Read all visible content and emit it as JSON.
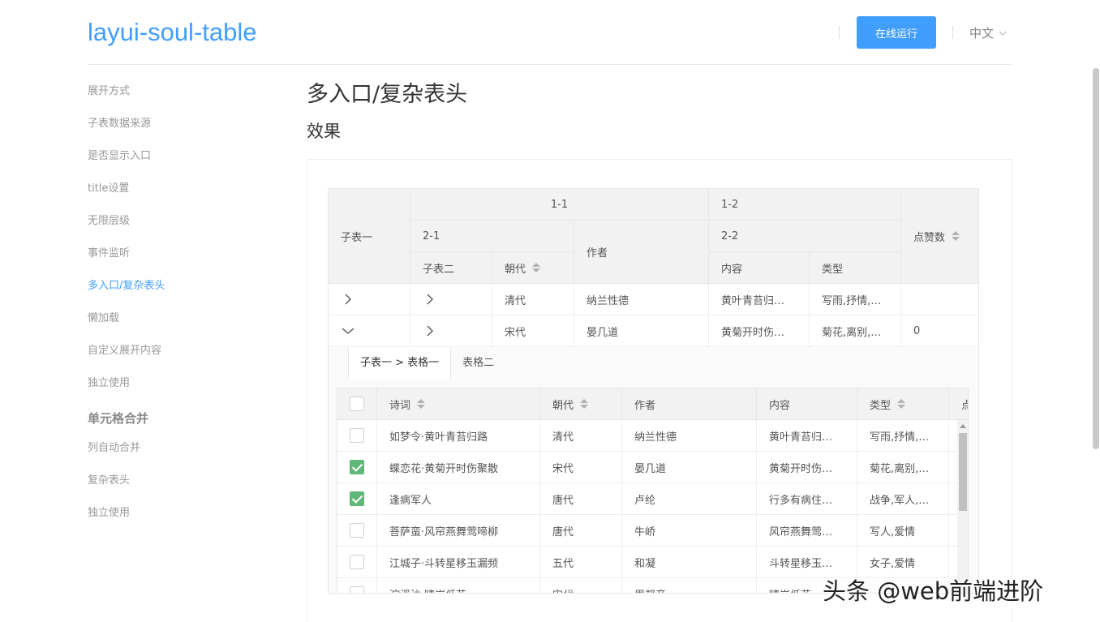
{
  "header": {
    "logo": "layui-soul-table",
    "run_button": "在线运行",
    "language": "中文"
  },
  "sidebar": {
    "items": [
      {
        "label": "展开方式"
      },
      {
        "label": "子表数据来源"
      },
      {
        "label": "是否显示入口"
      },
      {
        "label": "title设置"
      },
      {
        "label": "无限层级"
      },
      {
        "label": "事件监听"
      },
      {
        "label": "多入口/复杂表头",
        "active": true
      },
      {
        "label": "懒加载"
      },
      {
        "label": "自定义展开内容"
      },
      {
        "label": "独立使用"
      }
    ],
    "group_title": "单元格合并",
    "group_items": [
      {
        "label": "列自动合并"
      },
      {
        "label": "复杂表头"
      },
      {
        "label": "独立使用"
      }
    ]
  },
  "main": {
    "page_title": "多入口/复杂表头",
    "section_title": "效果"
  },
  "outer_table": {
    "headers": {
      "col_child1": "子表一",
      "group_1_1": "1-1",
      "group_1_2": "1-2",
      "group_2_1": "2-1",
      "group_2_2": "2-2",
      "col_child2": "子表二",
      "col_dynasty": "朝代",
      "col_author": "作者",
      "col_content": "内容",
      "col_type": "类型",
      "col_likes": "点赞数"
    },
    "rows": [
      {
        "dynasty": "清代",
        "author": "纳兰性德",
        "content": "黄叶青苔归…",
        "type": "写雨,抒情,…",
        "likes": "",
        "expanded": false
      },
      {
        "dynasty": "宋代",
        "author": "晏几道",
        "content": "黄菊开时伤…",
        "type": "菊花,离别,…",
        "likes": "0",
        "expanded": true
      }
    ]
  },
  "expand": {
    "tabs": [
      "子表一 > 表格一",
      "表格二"
    ],
    "active_tab": 0
  },
  "inner_table": {
    "headers": {
      "poem": "诗词",
      "dynasty": "朝代",
      "author": "作者",
      "content": "内容",
      "type": "类型",
      "likes_partial": "点"
    },
    "rows": [
      {
        "checked": false,
        "poem": "如梦令·黄叶青苔归路",
        "dynasty": "清代",
        "author": "纳兰性德",
        "content": "黄叶青苔归…",
        "type": "写雨,抒情,…"
      },
      {
        "checked": true,
        "poem": "蝶恋花·黄菊开时伤聚散",
        "dynasty": "宋代",
        "author": "晏几道",
        "content": "黄菊开时伤…",
        "type": "菊花,离别,…"
      },
      {
        "checked": true,
        "poem": "逢病军人",
        "dynasty": "唐代",
        "author": "卢纶",
        "content": "行多有病住…",
        "type": "战争,军人,…"
      },
      {
        "checked": false,
        "poem": "菩萨蛮·风帘燕舞莺啼柳",
        "dynasty": "唐代",
        "author": "牛峤",
        "content": "风帘燕舞莺…",
        "type": "写人,爱情"
      },
      {
        "checked": false,
        "poem": "江城子·斗转星移玉漏频",
        "dynasty": "五代",
        "author": "和凝",
        "content": "斗转星移玉…",
        "type": "女子,爱情"
      },
      {
        "checked": false,
        "poem": "浣溪沙·晴岸低花",
        "dynasty": "宋代",
        "author": "周邦彦",
        "content": "晴岸低花…",
        "type": ""
      }
    ]
  },
  "watermark": "头条 @web前端进阶"
}
